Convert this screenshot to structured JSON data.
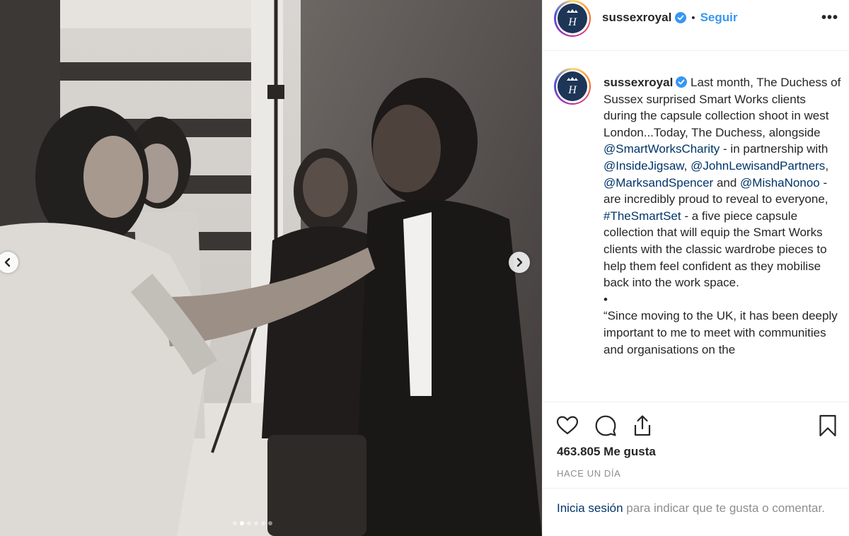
{
  "account": {
    "username": "sussexroyal",
    "avatar_monogram": "H",
    "follow_label": "Seguir",
    "separator": "•",
    "more_label": "•••"
  },
  "caption": {
    "username": "sussexroyal",
    "text_1": " Last month, The Duchess of Sussex surprised Smart Works clients during the capsule collection shoot in west London...Today, The Duchess, alongside ",
    "mention_1": "@SmartWorksCharity",
    "text_2": " - in partnership with ",
    "mention_2": "@InsideJigsaw",
    "text_3": ", ",
    "mention_3": "@JohnLewisandPartners",
    "text_4": ", ",
    "mention_4": "@MarksandSpencer",
    "text_5": " and ",
    "mention_5": "@MishaNonoo",
    "text_6": " - are incredibly proud to reveal to everyone, ",
    "hashtag_1": "#TheSmartSet",
    "text_7": " - a five piece capsule collection that will equip the Smart Works clients with the classic wardrobe pieces to help them feel confident as they mobilise back into the work space.",
    "bullet": "•",
    "quote": "“Since moving to the UK, it has been deeply important to me to meet with communities and organisations on the"
  },
  "actions": {
    "icons": [
      "heart-icon",
      "comment-icon",
      "share-icon",
      "bookmark-icon"
    ],
    "likes": "463.805 Me gusta",
    "timestamp": "HACE UN DÍA"
  },
  "login_prompt": {
    "link": "Inicia sesión",
    "rest": " para indicar que te gusta o comentar."
  },
  "carousel": {
    "total_dots": 6,
    "active_index": 1
  },
  "colors": {
    "link_blue": "#3897f0",
    "mention_navy": "#003569",
    "verified_blue": "#3897f0",
    "muted_gray": "#8e8e8e"
  }
}
